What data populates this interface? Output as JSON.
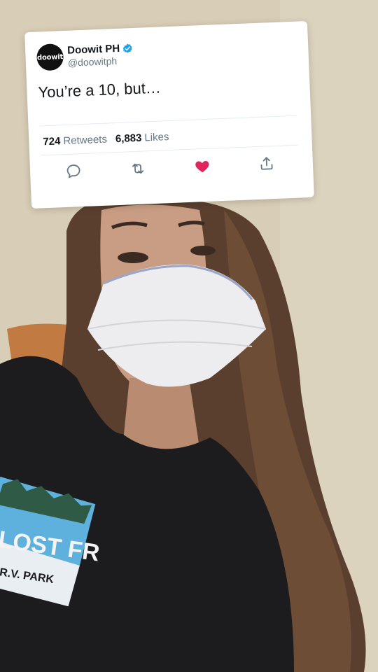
{
  "tweet": {
    "avatar_text": "doowit",
    "display_name": "Doowit PH",
    "handle": "@doowitph",
    "text": "You’re a 10, but…",
    "retweets_count": "724",
    "retweets_label": "Retweets",
    "likes_count": "6,883",
    "likes_label": "Likes",
    "icons": [
      "reply-icon",
      "retweet-icon",
      "like-icon",
      "share-icon"
    ],
    "colors": {
      "verified": "#1da1f2",
      "like": "#e0245e",
      "icon": "#657786"
    }
  },
  "photo": {
    "shirt_print": [
      "LOST FR",
      "R.V. PARK"
    ]
  }
}
